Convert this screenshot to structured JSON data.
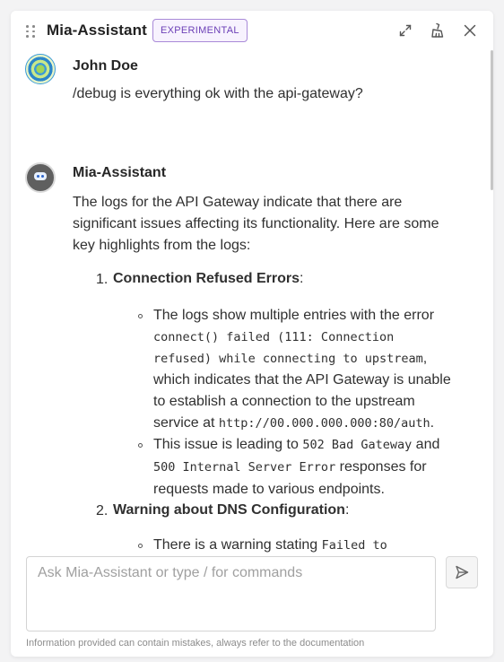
{
  "header": {
    "title": "Mia-Assistant",
    "badge": "EXPERIMENTAL",
    "icons": [
      "drag-handle-icon",
      "expand-icon",
      "clear-chat-icon",
      "close-icon"
    ]
  },
  "messages": [
    {
      "author": "John Doe",
      "text": "/debug is everything ok with the api-gateway?"
    },
    {
      "author": "Mia-Assistant",
      "intro": [
        "The logs for the API Gateway indicate that there are",
        "significant issues affecting its functionality. Here are some",
        "key highlights from the logs:"
      ],
      "items": [
        {
          "num": "1.",
          "heading": "Connection Refused Errors",
          "suffix": ":",
          "bullets": [
            {
              "lines": [
                {
                  "t": "The logs show multiple entries with the error"
                },
                {
                  "code": "connect() failed (111: Connection"
                },
                {
                  "code": "refused) while connecting to upstream",
                  "t2": ","
                },
                {
                  "t": "which indicates that the API Gateway is unable"
                },
                {
                  "t": "to establish a connection to the upstream"
                },
                {
                  "t": "service at ",
                  "code": "http://00.000.000.000:80/auth",
                  "t2": "."
                }
              ]
            },
            {
              "lines": [
                {
                  "t": "This issue is leading to ",
                  "code": "502 Bad Gateway",
                  "t2": " and"
                },
                {
                  "code": "500 Internal Server Error",
                  "t2": " responses for"
                },
                {
                  "t": "requests made to various endpoints."
                }
              ]
            }
          ]
        },
        {
          "num": "2.",
          "heading": "Warning about DNS Configuration",
          "suffix": ":",
          "bullets": [
            {
              "lines": [
                {
                  "t": "There is a warning stating ",
                  "code": "Failed to"
                }
              ]
            }
          ]
        }
      ]
    }
  ],
  "composer": {
    "placeholder": "Ask Mia-Assistant or type / for commands",
    "send_icon": "send-icon"
  },
  "footer_note": "Information provided can contain mistakes, always refer to the documentation"
}
